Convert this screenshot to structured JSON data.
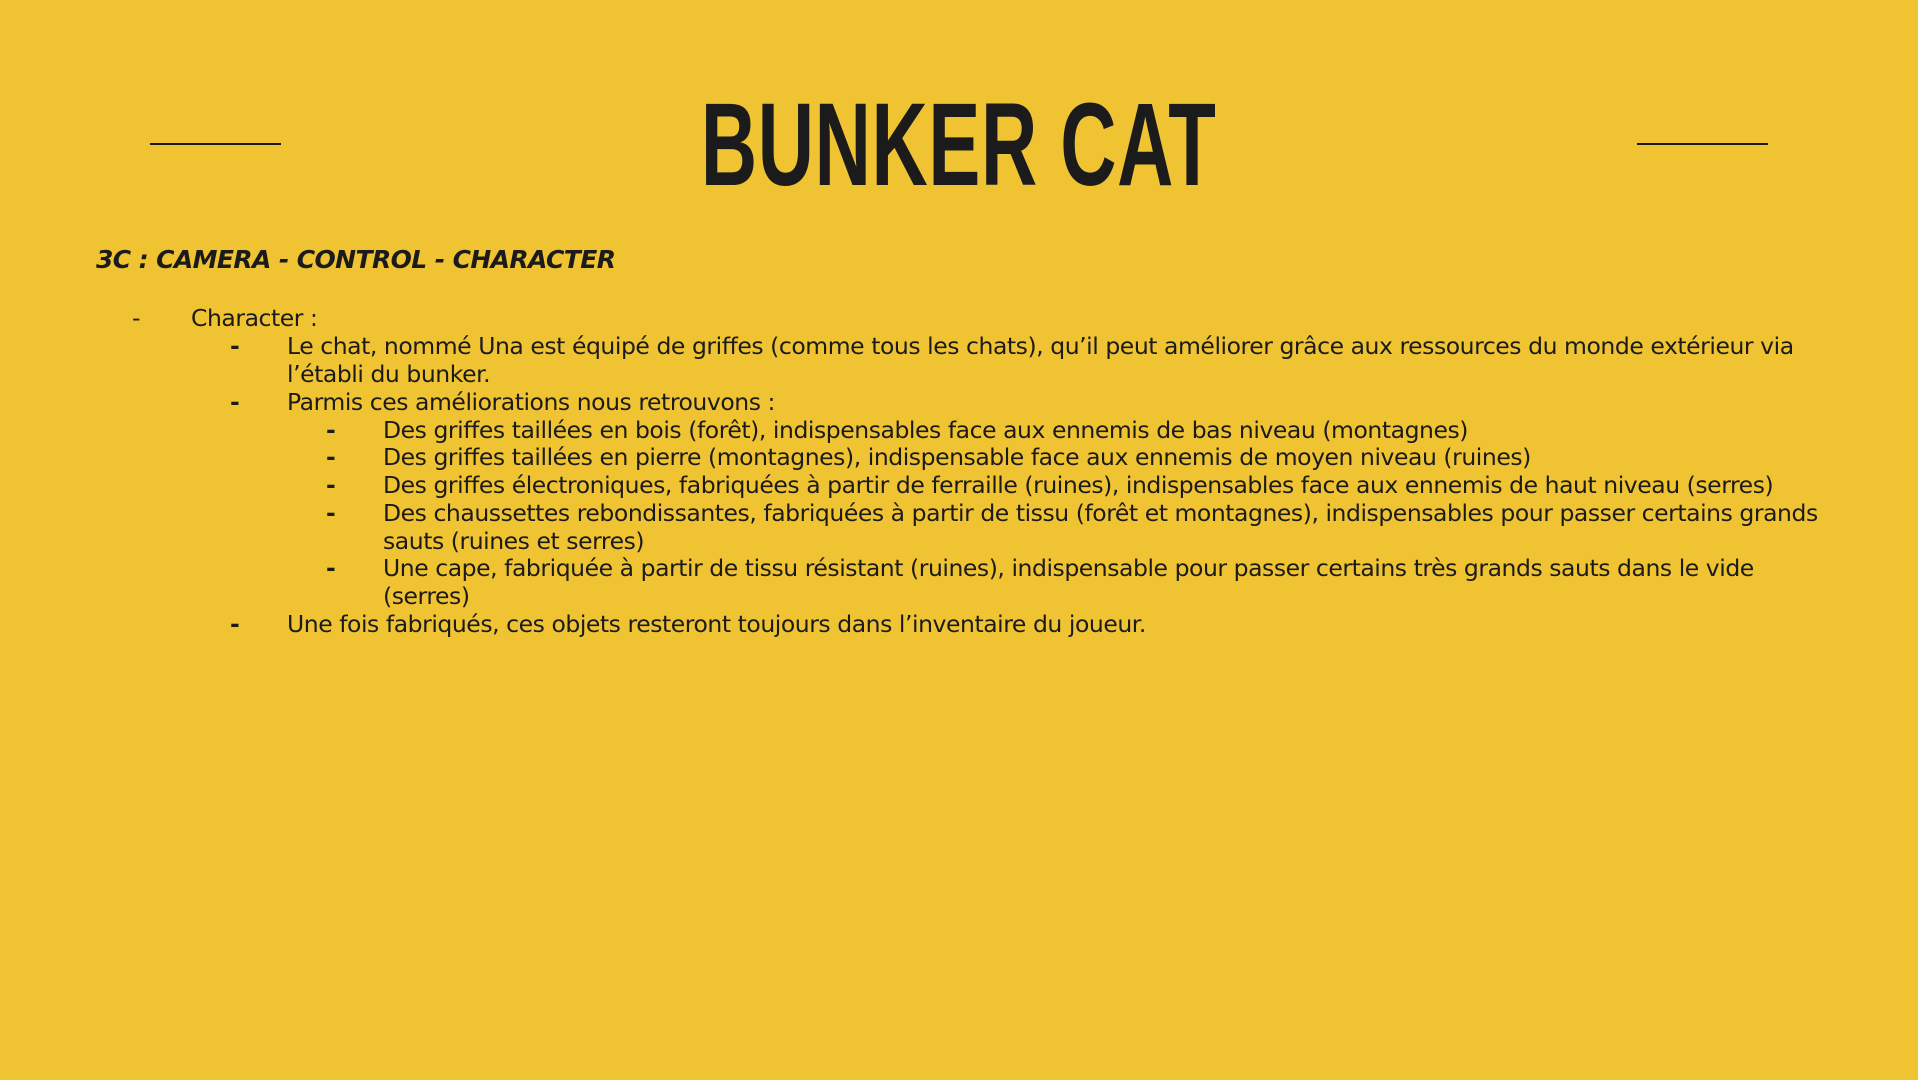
{
  "title": "BUNKER CAT",
  "subtitle": "3C : CAMERA - CONTROL - CHARACTER",
  "bullet_marker": "-",
  "sections": {
    "character": {
      "label": "Character :",
      "items": [
        "Le chat, nommé Una est équipé de griffes (comme tous les chats), qu’il peut améliorer grâce aux ressources du monde extérieur via l’établi du bunker.",
        "Parmis ces améliorations nous retrouvons :"
      ],
      "upgrades": [
        "Des griffes taillées en bois (forêt), indispensables face aux ennemis de bas niveau (montagnes)",
        "Des griffes taillées en pierre (montagnes), indispensable face aux ennemis de moyen niveau (ruines)",
        "Des griffes électroniques, fabriquées à partir de ferraille (ruines), indispensables face aux ennemis de haut niveau (serres)",
        "Des chaussettes rebondissantes, fabriquées à partir de tissu (forêt et montagnes), indispensables pour passer certains grands sauts (ruines et serres)",
        "Une cape, fabriquée à partir de tissu résistant (ruines), indispensable pour passer certains très grands sauts dans le vide (serres)"
      ],
      "closing": "Une fois fabriqués, ces objets resteront toujours dans l’inventaire du joueur."
    }
  },
  "colors": {
    "background": "#F0C332",
    "text": "#1b1b1b"
  }
}
